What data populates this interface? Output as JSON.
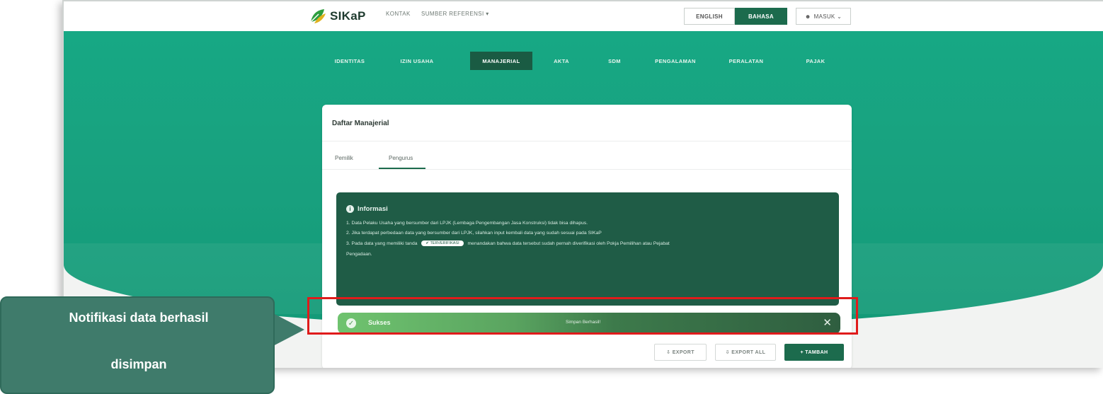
{
  "app": {
    "logo_text": "SIKaP",
    "top_links": [
      "KONTAK",
      "SUMBER REFERENSI ▾"
    ],
    "lang_en": "ENGLISH",
    "lang_id": "BAHASA",
    "login": "MASUK ⌄"
  },
  "nav": {
    "items": [
      "IDENTITAS",
      "IZIN USAHA",
      "MANAJERIAL",
      "AKTA",
      "SDM",
      "PENGALAMAN",
      "PERALATAN",
      "PAJAK"
    ],
    "active": "MANAJERIAL"
  },
  "card": {
    "title": "Daftar Manajerial",
    "tabs": [
      "Pemilik",
      "Pengurus"
    ],
    "active_tab": "Pengurus"
  },
  "info": {
    "heading": "Informasi",
    "line1": "1. Data Pelaku Usaha yang bersumber dari LPJK (Lembaga Pengembangan Jasa Konstruksi) tidak bisa dihapus.",
    "line2": "2. Jika terdapat perbedaan data yang bersumber dari LPJK, silahkan input kembali data yang sudah sesuai pada SIKaP",
    "line3a": "3. Pada data yang memiliki tanda",
    "badge": "✔ TERVERIFIKASI",
    "line3b": "menandakan bahwa data tersebut sudah pernah diverifikasi oleh Pokja Pemilihan atau Pejabat",
    "line4": "Pengadaan."
  },
  "toast": {
    "title": "Sukses",
    "message": "Simpan Berhasil!",
    "close": "✕"
  },
  "actions": {
    "export": "⇩ EXPORT",
    "export_all": "⇩ EXPORT ALL",
    "tambah": "+ TAMBAH"
  },
  "callout": {
    "line1": "Notifikasi data berhasil",
    "line2": "disimpan"
  },
  "colors": {
    "brand_green": "#1c6b4d",
    "hero_green": "#17a884",
    "highlight_red": "#e01b1b",
    "callout_bg": "#3f7b6b"
  }
}
